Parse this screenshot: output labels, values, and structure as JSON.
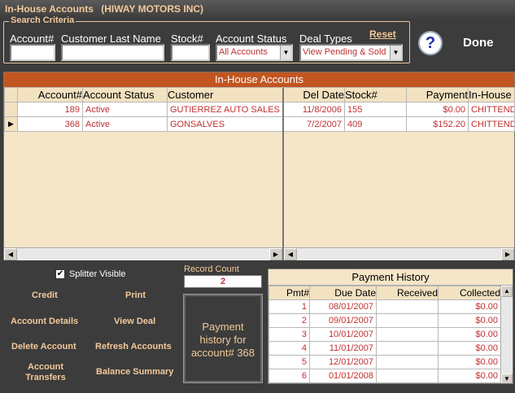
{
  "window": {
    "title": "In-House Accounts",
    "company": "(HIWAY MOTORS INC)"
  },
  "search": {
    "legend": "Search Criteria",
    "account_label": "Account#",
    "last_name_label": "Customer Last Name",
    "stock_label": "Stock#",
    "status_label": "Account Status",
    "status_value": "All Accounts",
    "deal_types_label": "Deal Types",
    "deal_types_value": "View Pending & Sold",
    "reset_label": "Reset"
  },
  "toolbar": {
    "help_glyph": "?",
    "done_label": "Done"
  },
  "accounts": {
    "title": "In-House Accounts",
    "columns": [
      "Account#",
      "Account Status",
      "Customer",
      "Del Date",
      "Stock#",
      "Payment",
      "In-House"
    ],
    "rows": [
      {
        "account": "189",
        "status": "Active",
        "customer": "GUTIERREZ AUTO SALES",
        "del_date": "11/8/2006",
        "stock": "155",
        "payment": "$0.00",
        "inhouse": "CHITTEND"
      },
      {
        "account": "368",
        "status": "Active",
        "customer": "GONSALVES",
        "del_date": "7/2/2007",
        "stock": "409",
        "payment": "$152.20",
        "inhouse": "CHITTEND"
      }
    ]
  },
  "actions": {
    "splitter_label": "Splitter Visible",
    "credit": "Credit",
    "print": "Print",
    "account_details": "Account Details",
    "view_deal": "View Deal",
    "delete_account": "Delete Account",
    "refresh_accounts": "Refresh Accounts",
    "account_transfers": "Account Transfers",
    "balance_summary": "Balance Summary"
  },
  "record_count": {
    "label": "Record Count",
    "value": "2"
  },
  "payment_note": "Payment history for account# 368",
  "payment_history": {
    "title": "Payment History",
    "columns": [
      "Pmt#",
      "Due Date",
      "Received",
      "Collected"
    ],
    "rows": [
      {
        "pmt": "1",
        "due": "08/01/2007",
        "received": "",
        "collected": "$0.00"
      },
      {
        "pmt": "2",
        "due": "09/01/2007",
        "received": "",
        "collected": "$0.00"
      },
      {
        "pmt": "3",
        "due": "10/01/2007",
        "received": "",
        "collected": "$0.00"
      },
      {
        "pmt": "4",
        "due": "11/01/2007",
        "received": "",
        "collected": "$0.00"
      },
      {
        "pmt": "5",
        "due": "12/01/2007",
        "received": "",
        "collected": "$0.00"
      },
      {
        "pmt": "6",
        "due": "01/01/2008",
        "received": "",
        "collected": "$0.00"
      }
    ]
  }
}
